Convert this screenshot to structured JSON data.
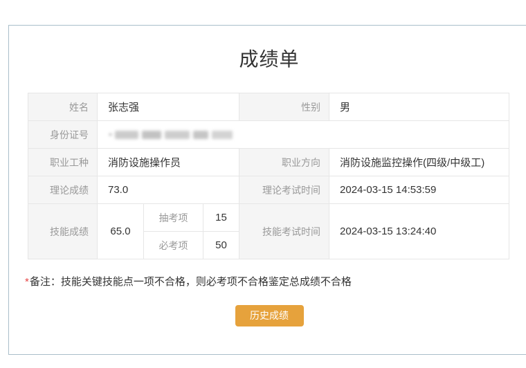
{
  "page": {
    "title": "成绩单"
  },
  "table": {
    "name_label": "姓名",
    "name_value": "张志强",
    "gender_label": "性别",
    "gender_value": "男",
    "id_label": "身份证号",
    "occupation_label": "职业工种",
    "occupation_value": "消防设施操作员",
    "direction_label": "职业方向",
    "direction_value": "消防设施监控操作(四级/中级工)",
    "theory_score_label": "理论成绩",
    "theory_score_value": "73.0",
    "theory_time_label": "理论考试时间",
    "theory_time_value": "2024-03-15 14:53:59",
    "skill_score_label": "技能成绩",
    "skill_score_value": "65.0",
    "sampled_label": "抽考项",
    "sampled_value": "15",
    "required_label": "必考项",
    "required_value": "50",
    "skill_time_label": "技能考试时间",
    "skill_time_value": "2024-03-15 13:24:40"
  },
  "note": {
    "asterisk": "*",
    "text": "备注：技能关键技能点一项不合格，则必考项不合格鉴定总成绩不合格"
  },
  "actions": {
    "history_button_label": "历史成绩"
  },
  "colors": {
    "accent_orange": "#e6a23c",
    "score_blue": "#409eff",
    "panel_border": "#a9bec9",
    "note_red": "#e64545",
    "label_bg": "#f5f5f5",
    "table_border": "#e6e6e6"
  }
}
